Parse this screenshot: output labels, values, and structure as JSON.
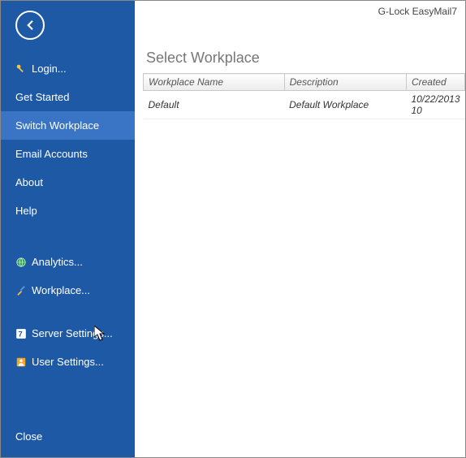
{
  "app_title": "G-Lock EasyMail7",
  "sidebar": {
    "items": [
      {
        "label": "Login...",
        "icon": "key-icon",
        "active": false
      },
      {
        "label": "Get Started",
        "icon": null,
        "active": false
      },
      {
        "label": "Switch  Workplace",
        "icon": null,
        "active": true
      },
      {
        "label": "Email Accounts",
        "icon": null,
        "active": false
      },
      {
        "label": "About",
        "icon": null,
        "active": false
      },
      {
        "label": "Help",
        "icon": null,
        "active": false
      }
    ],
    "tools": [
      {
        "label": "Analytics...",
        "icon": "globe-icon"
      },
      {
        "label": "Workplace...",
        "icon": "tools-icon"
      },
      {
        "label": "Server Settings...",
        "icon": "seven-icon"
      },
      {
        "label": "User Settings...",
        "icon": "user-icon"
      }
    ],
    "close_label": "Close"
  },
  "main": {
    "heading": "Select Workplace",
    "columns": {
      "name": "Workplace Name",
      "desc": "Description",
      "created": "Created"
    },
    "rows": [
      {
        "name": "Default",
        "desc": "Default Workplace",
        "created": "10/22/2013 10"
      }
    ]
  }
}
